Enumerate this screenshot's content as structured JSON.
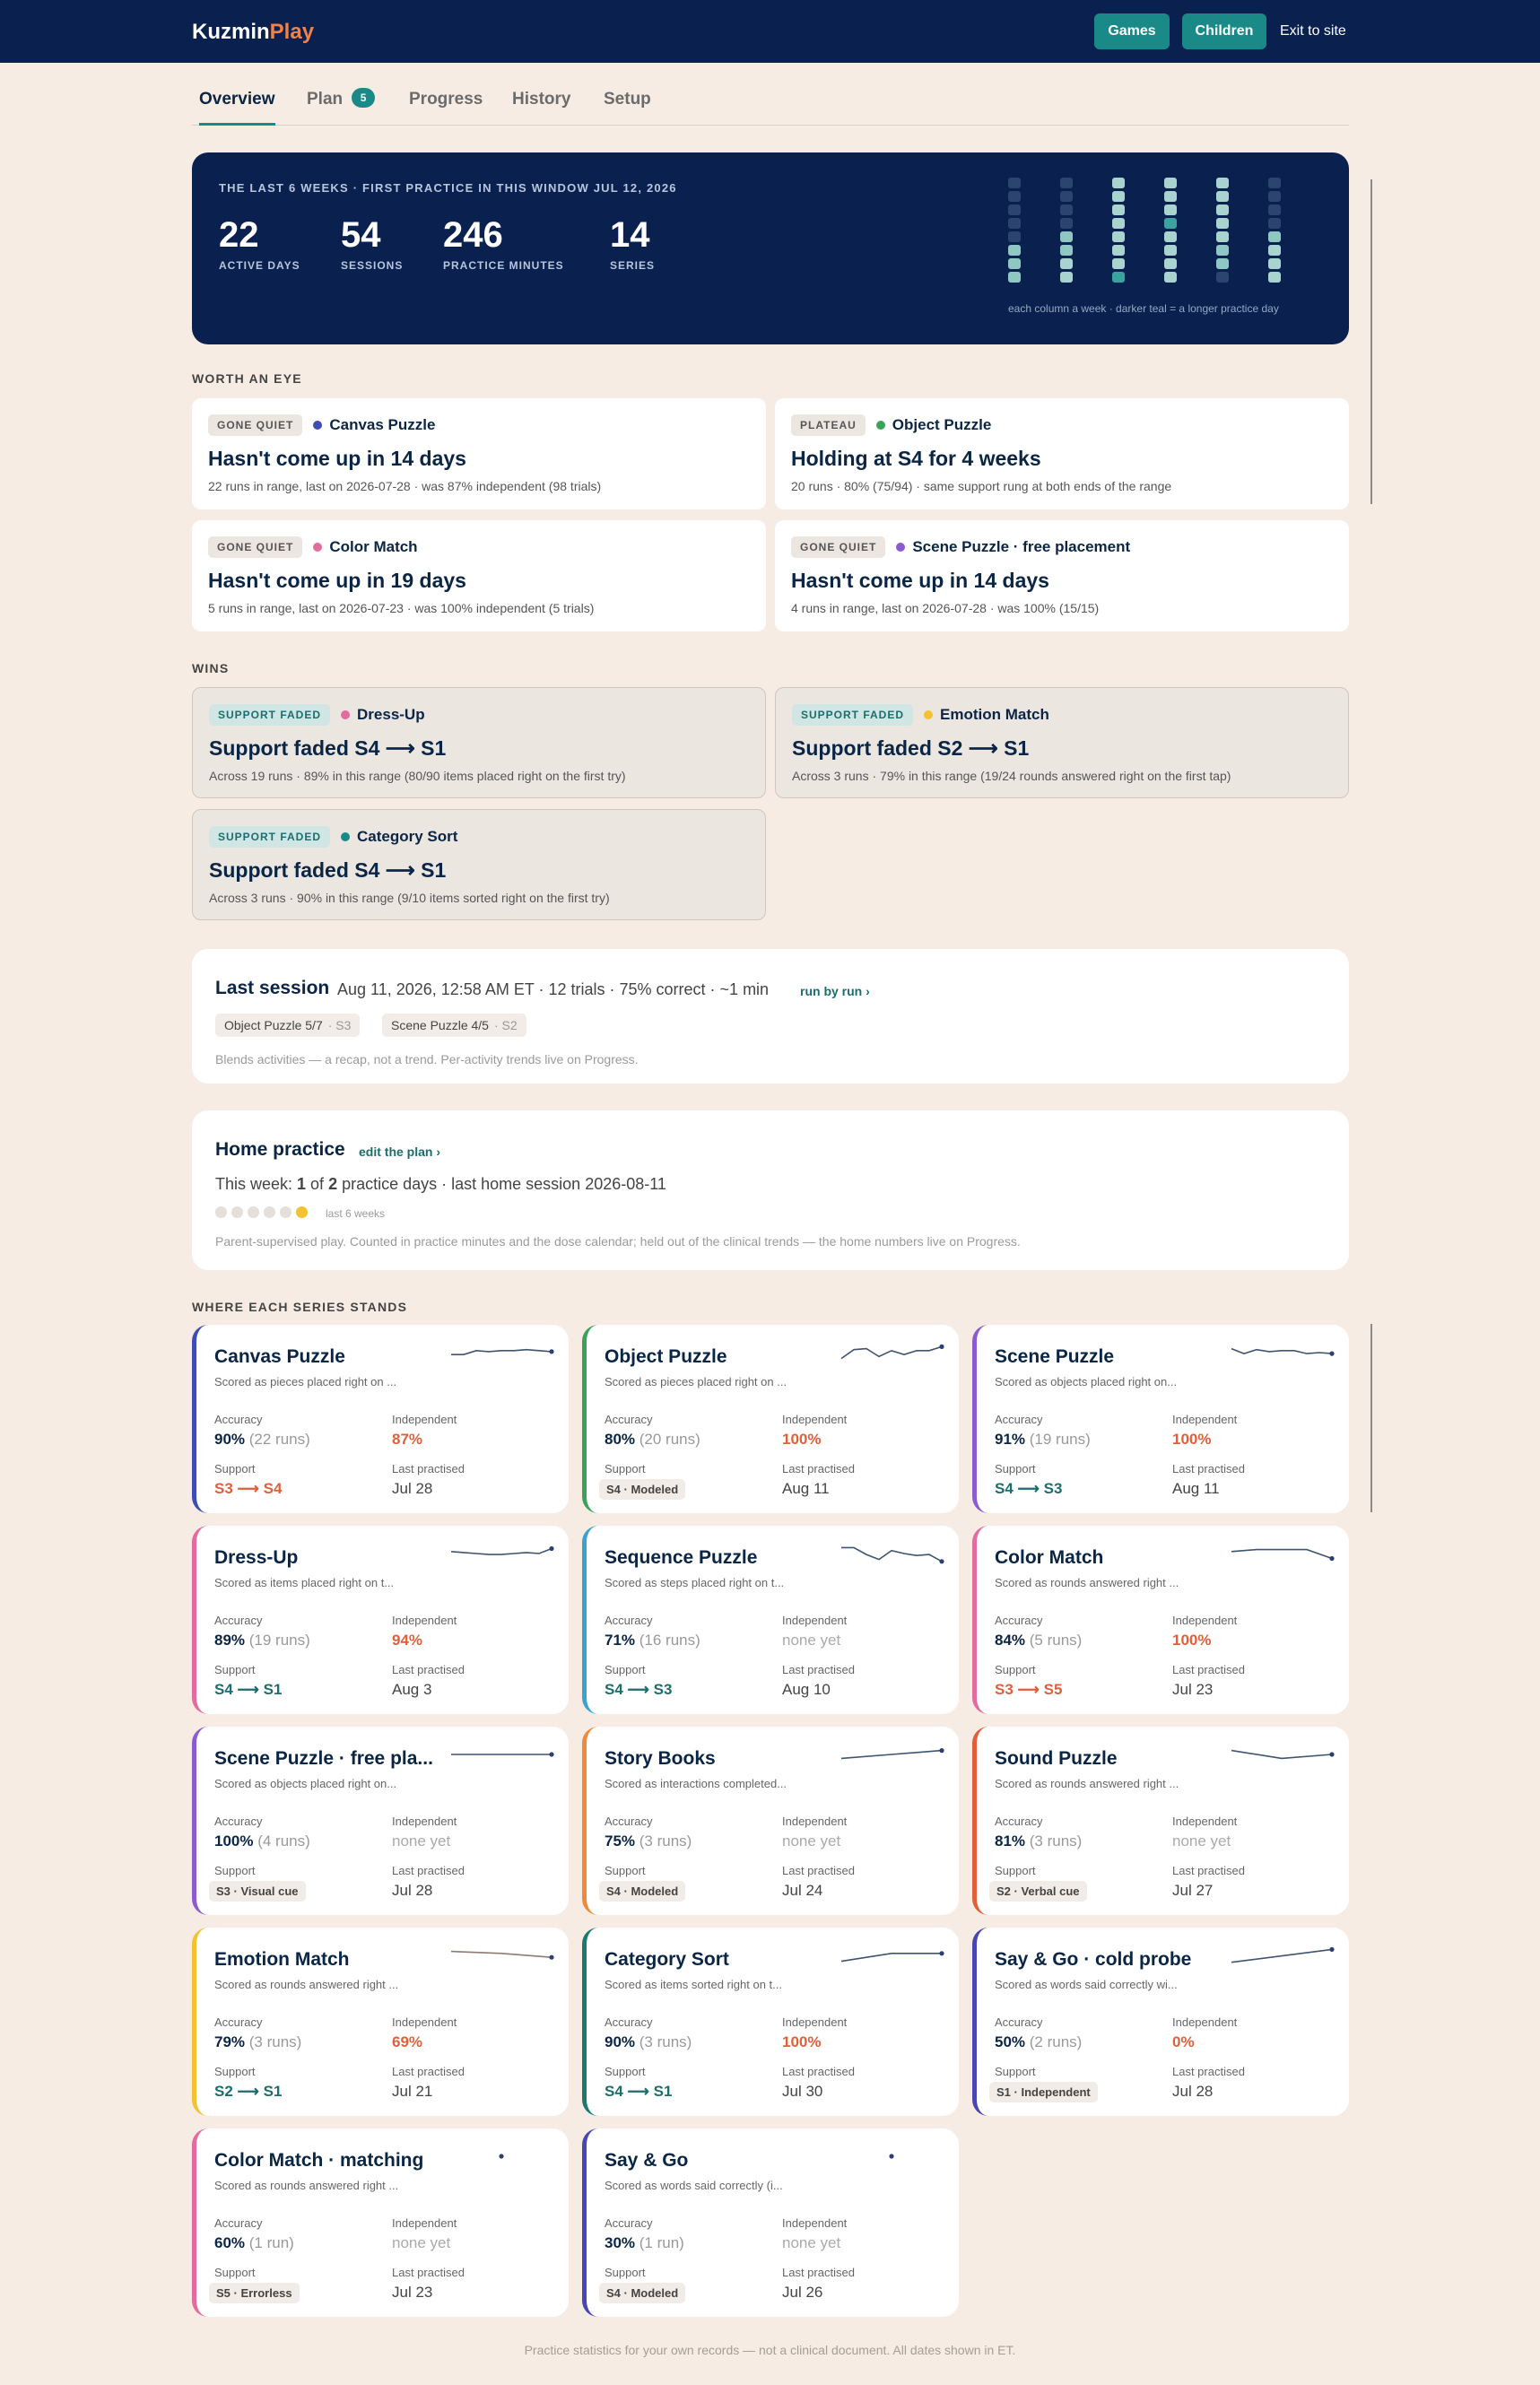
{
  "topbar": {
    "brand_main": "Kuzmin",
    "brand_accent": "Play",
    "games_label": "Games",
    "children_label": "Children",
    "exit_label": "Exit to site"
  },
  "tabs": [
    {
      "label": "Overview",
      "active": true
    },
    {
      "label": "Plan",
      "badge": "5"
    },
    {
      "label": "Progress"
    },
    {
      "label": "History"
    },
    {
      "label": "Setup"
    }
  ],
  "hero": {
    "caption": "THE LAST 6 WEEKS · FIRST PRACTICE IN THIS WINDOW JUL 12, 2026",
    "stats": [
      {
        "value": "22",
        "label": "ACTIVE DAYS"
      },
      {
        "value": "54",
        "label": "SESSIONS"
      },
      {
        "value": "246",
        "label": "PRACTICE MINUTES"
      },
      {
        "value": "14",
        "label": "SERIES"
      }
    ],
    "legend": "each column a week · darker teal = a longer practice day",
    "weeks": [
      [
        0,
        0,
        0,
        0,
        0,
        1,
        1,
        1
      ],
      [
        0,
        0,
        0,
        0,
        1,
        1,
        2,
        2
      ],
      [
        2,
        2,
        2,
        2,
        2,
        2,
        2,
        3
      ],
      [
        2,
        2,
        2,
        3,
        2,
        2,
        2,
        2
      ],
      [
        2,
        2,
        2,
        2,
        2,
        1,
        1,
        0
      ],
      [
        0,
        0,
        0,
        0,
        1,
        2,
        2,
        2
      ]
    ]
  },
  "worth_an_eye": {
    "label": "WORTH AN EYE",
    "cards": [
      {
        "tag": "GONE QUIET",
        "activity": "Canvas Puzzle",
        "color": "#3d4db7",
        "title": "Hasn't come up in 14 days",
        "sub": "22 runs in range, last on 2026-07-28 · was 87% independent (98 trials)"
      },
      {
        "tag": "PLATEAU",
        "activity": "Object Puzzle",
        "color": "#3aa35a",
        "title": "Holding at S4 for 4 weeks",
        "sub": "20 runs · 80% (75/94) · same support rung at both ends of the range"
      },
      {
        "tag": "GONE QUIET",
        "activity": "Color Match",
        "color": "#e46b9e",
        "title": "Hasn't come up in 19 days",
        "sub": "5 runs in range, last on 2026-07-23 · was 100% independent (5 trials)"
      },
      {
        "tag": "GONE QUIET",
        "activity": "Scene Puzzle · free placement",
        "color": "#8d5bd1",
        "title": "Hasn't come up in 14 days",
        "sub": "4 runs in range, last on 2026-07-28 · was 100% (15/15)"
      }
    ]
  },
  "wins": {
    "label": "WINS",
    "cards": [
      {
        "tag": "SUPPORT FADED",
        "activity": "Dress-Up",
        "color": "#e46b9e",
        "title": "Support faded S4 ⟶ S1",
        "sub": "Across 19 runs · 89% in this range (80/90 items placed right on the first try)"
      },
      {
        "tag": "SUPPORT FADED",
        "activity": "Emotion Match",
        "color": "#f2c230",
        "title": "Support faded S2 ⟶ S1",
        "sub": "Across 3 runs · 79% in this range (19/24 rounds answered right on the first tap)"
      },
      {
        "tag": "SUPPORT FADED",
        "activity": "Category Sort",
        "color": "#1a8a89",
        "title": "Support faded S4 ⟶ S1",
        "sub": "Across 3 runs · 90% in this range (9/10 items sorted right on the first try)"
      }
    ]
  },
  "last_session": {
    "heading": "Last session",
    "meta": "Aug 11, 2026, 12:58 AM ET · 12 trials · 75% correct · ~1 min",
    "link": "run by run ›",
    "chips": [
      {
        "label": "Object Puzzle 5/7",
        "sub": "· S3"
      },
      {
        "label": "Scene Puzzle 4/5",
        "sub": "· S2"
      }
    ],
    "note": "Blends activities — a recap, not a trend. Per-activity trends live on Progress."
  },
  "home_practice": {
    "heading": "Home practice",
    "link": "edit the plan ›",
    "week_prefix": "This week: ",
    "week_done": "1",
    "week_of": " of ",
    "week_total": "2",
    "week_suffix": " practice days · last home session 2026-08-11",
    "weeks_label": "last 6 weeks",
    "week_dots": [
      0,
      0,
      0,
      0,
      0,
      1
    ],
    "note": "Parent-supervised play. Counted in practice minutes and the dose calendar; held out of the clinical trends — the home numbers live on Progress."
  },
  "series": {
    "label": "WHERE EACH SERIES STANDS",
    "accuracy_label": "Accuracy",
    "independent_label": "Independent",
    "support_label": "Support",
    "last_label": "Last practised",
    "cards": [
      {
        "name": "Canvas Puzzle",
        "color": "#3d4db7",
        "desc": "Scored as pieces placed right on ...",
        "acc": "90%",
        "runs": "(22 runs)",
        "indep": "87%",
        "indep_style": "accent",
        "support": "S3 ⟶ S4",
        "support_style": "orange",
        "last": "Jul 28",
        "spark": [
          0.6,
          0.6,
          0.4,
          0.45,
          0.4,
          0.4,
          0.35,
          0.4,
          0.45
        ]
      },
      {
        "name": "Object Puzzle",
        "color": "#3aa35a",
        "desc": "Scored as pieces placed right on ...",
        "acc": "80%",
        "runs": "(20 runs)",
        "indep": "100%",
        "indep_style": "accent",
        "support": "S4 · Modeled",
        "support_style": "chipped",
        "last": "Aug 11",
        "spark": [
          0.8,
          0.35,
          0.3,
          0.7,
          0.4,
          0.6,
          0.4,
          0.4,
          0.2
        ]
      },
      {
        "name": "Scene Puzzle",
        "color": "#8d5bd1",
        "desc": "Scored as objects placed right on...",
        "acc": "91%",
        "runs": "(19 runs)",
        "indep": "100%",
        "indep_style": "accent",
        "support": "S4 ⟶ S3",
        "support_style": "teal",
        "last": "Aug 11",
        "spark": [
          0.3,
          0.55,
          0.35,
          0.45,
          0.4,
          0.4,
          0.55,
          0.5,
          0.55
        ]
      },
      {
        "name": "Dress-Up",
        "color": "#e46b9e",
        "desc": "Scored as items placed right on t...",
        "acc": "89%",
        "runs": "(19 runs)",
        "indep": "94%",
        "indep_style": "accent",
        "support": "S4 ⟶ S1",
        "support_style": "teal",
        "last": "Aug 3",
        "spark": [
          0.4,
          0.45,
          0.5,
          0.55,
          0.55,
          0.5,
          0.45,
          0.5,
          0.25
        ]
      },
      {
        "name": "Sequence Puzzle",
        "color": "#3ba3d0",
        "desc": "Scored as steps placed right on t...",
        "acc": "71%",
        "runs": "(16 runs)",
        "indep": "none yet",
        "indep_style": "none",
        "support": "S4 ⟶ S3",
        "support_style": "teal",
        "last": "Aug 10",
        "spark": [
          0.2,
          0.2,
          0.55,
          0.8,
          0.35,
          0.5,
          0.6,
          0.55,
          0.9
        ]
      },
      {
        "name": "Color Match",
        "color": "#e46b9e",
        "desc": "Scored as rounds answered right ...",
        "acc": "84%",
        "runs": "(5 runs)",
        "indep": "100%",
        "indep_style": "accent",
        "support": "S3 ⟶ S5",
        "support_style": "orange",
        "last": "Jul 23",
        "spark": [
          0.4,
          0.3,
          0.3,
          0.3,
          0.75
        ]
      },
      {
        "name": "Scene Puzzle · free pla...",
        "color": "#8d5bd1",
        "desc": "Scored as objects placed right on...",
        "acc": "100%",
        "runs": "(4 runs)",
        "indep": "none yet",
        "indep_style": "none",
        "support": "S3 · Visual cue",
        "support_style": "chipped",
        "last": "Jul 28",
        "spark": [
          0.5,
          0.5,
          0.5,
          0.5
        ]
      },
      {
        "name": "Story Books",
        "color": "#ee8a3a",
        "desc": "Scored as interactions completed...",
        "acc": "75%",
        "runs": "(3 runs)",
        "indep": "none yet",
        "indep_style": "none",
        "support": "S4 · Modeled",
        "support_style": "chipped",
        "last": "Jul 24",
        "spark": [
          0.7,
          0.5,
          0.3
        ]
      },
      {
        "name": "Sound Puzzle",
        "color": "#e0603a",
        "desc": "Scored as rounds answered right ...",
        "acc": "81%",
        "runs": "(3 runs)",
        "indep": "none yet",
        "indep_style": "none",
        "support": "S2 · Verbal cue",
        "support_style": "chipped",
        "last": "Jul 27",
        "spark": [
          0.3,
          0.7,
          0.5
        ]
      },
      {
        "name": "Emotion Match",
        "color": "#f2c230",
        "desc": "Scored as rounds answered right ...",
        "acc": "79%",
        "runs": "(3 runs)",
        "indep": "69%",
        "indep_style": "accent",
        "support": "S2 ⟶ S1",
        "support_style": "teal",
        "last": "Jul 21",
        "spark": [
          0.3,
          0.4,
          0.6
        ]
      },
      {
        "name": "Category Sort",
        "color": "#1a7a70",
        "desc": "Scored as items sorted right on t...",
        "acc": "90%",
        "runs": "(3 runs)",
        "indep": "100%",
        "indep_style": "accent",
        "support": "S4 ⟶ S1",
        "support_style": "teal",
        "last": "Jul 30",
        "spark": [
          0.8,
          0.4,
          0.4
        ]
      },
      {
        "name": "Say & Go · cold probe",
        "color": "#4845b5",
        "desc": "Scored as words said correctly wi...",
        "acc": "50%",
        "runs": "(2 runs)",
        "indep": "0%",
        "indep_style": "accent",
        "support": "S1 · Independent",
        "support_style": "chipped",
        "last": "Jul 28",
        "spark": [
          0.85,
          0.2
        ]
      },
      {
        "name": "Color Match · matching",
        "color": "#e46b9e",
        "desc": "Scored as rounds answered right ...",
        "acc": "60%",
        "runs": "(1 run)",
        "indep": "none yet",
        "indep_style": "none",
        "support": "S5 · Errorless",
        "support_style": "chipped",
        "last": "Jul 23",
        "spark": [
          0.5
        ]
      },
      {
        "name": "Say & Go",
        "color": "#4845b5",
        "desc": "Scored as words said correctly (i...",
        "acc": "30%",
        "runs": "(1 run)",
        "indep": "none yet",
        "indep_style": "none",
        "support": "S4 · Modeled",
        "support_style": "chipped",
        "last": "Jul 26",
        "spark": [
          0.5
        ]
      }
    ]
  },
  "footer": "Practice statistics for your own records — not a clinical document. All dates shown in ET."
}
